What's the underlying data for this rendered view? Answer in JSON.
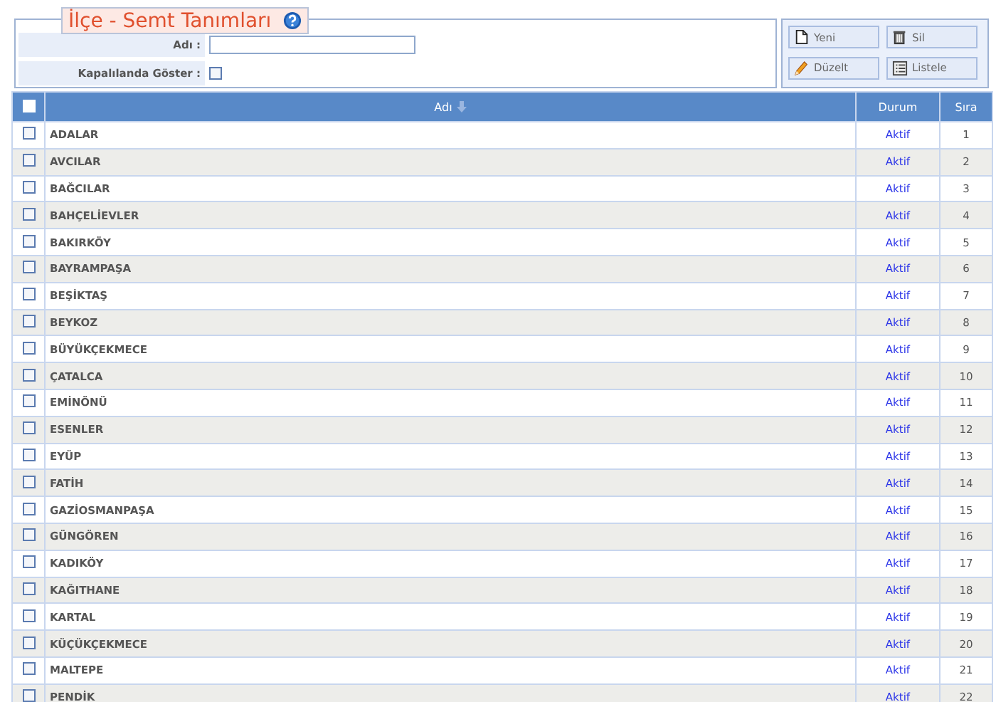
{
  "panel": {
    "title": "İlçe - Semt Tanımları",
    "fields": [
      {
        "kind": "text",
        "label": "Adı :"
      },
      {
        "kind": "checkbox",
        "label": "Kapalılanda Göster :",
        "checked": false
      }
    ]
  },
  "buttons": [
    {
      "kind": "new",
      "label": "Yeni"
    },
    {
      "kind": "delete",
      "label": "Sil"
    },
    {
      "kind": "edit",
      "label": "Düzelt"
    },
    {
      "kind": "list",
      "label": "Listele"
    }
  ],
  "table": {
    "all_checked": false,
    "columns": [
      "Adı",
      "Durum",
      "Sıra"
    ],
    "rows": [
      {
        "name": "ADALAR",
        "status": "Aktif",
        "order": "1",
        "checked": false
      },
      {
        "name": "AVCILAR",
        "status": "Aktif",
        "order": "2",
        "checked": false
      },
      {
        "name": "BAĞCILAR",
        "status": "Aktif",
        "order": "3",
        "checked": false
      },
      {
        "name": "BAHÇELİEVLER",
        "status": "Aktif",
        "order": "4",
        "checked": false
      },
      {
        "name": "BAKIRKÖY",
        "status": "Aktif",
        "order": "5",
        "checked": false
      },
      {
        "name": "BAYRAMPAŞA",
        "status": "Aktif",
        "order": "6",
        "checked": false
      },
      {
        "name": "BEŞİKTAŞ",
        "status": "Aktif",
        "order": "7",
        "checked": false
      },
      {
        "name": "BEYKOZ",
        "status": "Aktif",
        "order": "8",
        "checked": false
      },
      {
        "name": "BÜYÜKÇEKMECE",
        "status": "Aktif",
        "order": "9",
        "checked": false
      },
      {
        "name": "ÇATALCA",
        "status": "Aktif",
        "order": "10",
        "checked": false
      },
      {
        "name": "EMİNÖNÜ",
        "status": "Aktif",
        "order": "11",
        "checked": false
      },
      {
        "name": "ESENLER",
        "status": "Aktif",
        "order": "12",
        "checked": false
      },
      {
        "name": "EYÜP",
        "status": "Aktif",
        "order": "13",
        "checked": false
      },
      {
        "name": "FATİH",
        "status": "Aktif",
        "order": "14",
        "checked": false
      },
      {
        "name": "GAZİOSMANPAŞA",
        "status": "Aktif",
        "order": "15",
        "checked": false
      },
      {
        "name": "GÜNGÖREN",
        "status": "Aktif",
        "order": "16",
        "checked": false
      },
      {
        "name": "KADIKÖY",
        "status": "Aktif",
        "order": "17",
        "checked": false
      },
      {
        "name": "KAĞITHANE",
        "status": "Aktif",
        "order": "18",
        "checked": false
      },
      {
        "name": "KARTAL",
        "status": "Aktif",
        "order": "19",
        "checked": false
      },
      {
        "name": "KÜÇÜKÇEKMECE",
        "status": "Aktif",
        "order": "20",
        "checked": false
      },
      {
        "name": "MALTEPE",
        "status": "Aktif",
        "order": "21",
        "checked": false
      },
      {
        "name": "PENDİK",
        "status": "Aktif",
        "order": "22",
        "checked": false
      }
    ]
  }
}
